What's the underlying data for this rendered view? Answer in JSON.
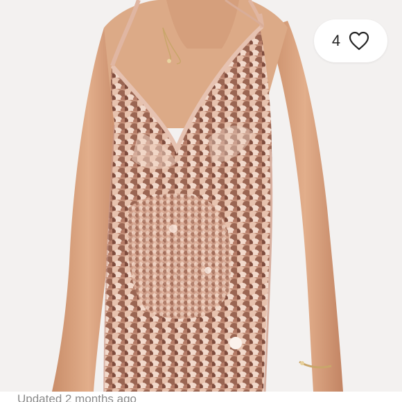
{
  "listing": {
    "photo_alt": "Rose gold sequin slip dress",
    "like_count": "4",
    "like_icon": "heart-outline-icon",
    "updated_text": "Updated 2 months ago"
  },
  "colors": {
    "sequin_base": "#c9967f",
    "sequin_dark": "#8a5a48",
    "sequin_light": "#f3d6c6",
    "skin": "#d9a27e",
    "background": "#f3f1f0",
    "text_muted": "#8a8a8a"
  }
}
